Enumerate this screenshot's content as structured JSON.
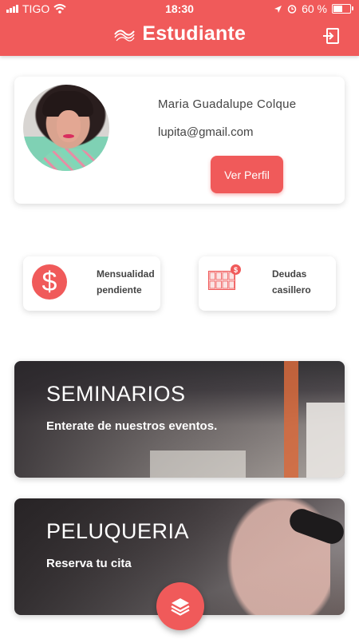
{
  "status_bar": {
    "carrier": "TIGO",
    "time": "18:30",
    "battery": "60 %",
    "battery_level": 0.6
  },
  "app_bar": {
    "title": "Estudiante",
    "logo_icon": "wave-logo-icon",
    "logout_icon": "logout-icon"
  },
  "profile": {
    "name": "Maria Guadalupe Colque",
    "email": "lupita@gmail.com",
    "button_label": "Ver Perfil"
  },
  "stats": [
    {
      "label_line1": "Mensualidad",
      "label_line2": "pendiente",
      "icon": "dollar-icon"
    },
    {
      "label_line1": "Deudas",
      "label_line2": "casillero",
      "icon": "locker-icon"
    }
  ],
  "banners": [
    {
      "title": "SEMINARIOS",
      "subtitle": "Enterate de nuestros eventos."
    },
    {
      "title": "PELUQUERIA",
      "subtitle": "Reserva tu cita"
    }
  ],
  "fab": {
    "icon": "layers-icon"
  },
  "colors": {
    "accent": "#f05a5a",
    "text": "#444444"
  }
}
